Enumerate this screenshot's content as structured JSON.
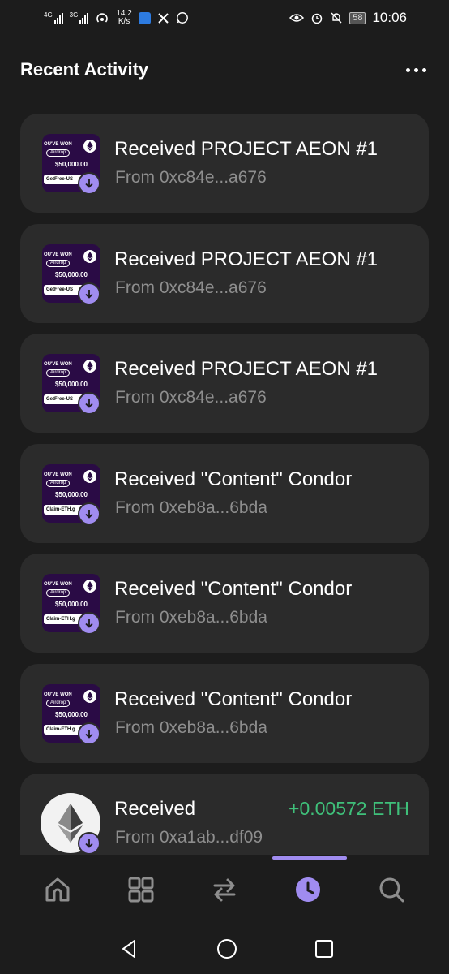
{
  "status_bar": {
    "signal1_label": "4G",
    "signal2_label": "3G",
    "speed_value": "14.2",
    "speed_unit": "K/s",
    "battery": "58",
    "time": "10:06"
  },
  "header": {
    "title": "Recent Activity"
  },
  "thumbnail": {
    "won_text": "OU'VE WON",
    "airdrop_text": "Airdrop",
    "amount_text": "$50,000.00",
    "claim_a": "GetFree-US",
    "claim_b": "Claim-ETH.g"
  },
  "activities": [
    {
      "title": "Received PROJECT AEON  #1",
      "from": "From 0xc84e...a676"
    },
    {
      "title": "Received PROJECT AEON  #1",
      "from": "From 0xc84e...a676"
    },
    {
      "title": "Received PROJECT AEON  #1",
      "from": "From 0xc84e...a676"
    },
    {
      "title": "Received \"Content\" Condor",
      "from": "From 0xeb8a...6bda"
    },
    {
      "title": "Received \"Content\" Condor",
      "from": "From 0xeb8a...6bda"
    },
    {
      "title": "Received \"Content\" Condor",
      "from": "From 0xeb8a...6bda"
    },
    {
      "title": "Received",
      "from": "From 0xa1ab...df09",
      "amount": "+0.00572 ETH"
    }
  ],
  "nav": {
    "items": [
      "home-icon",
      "grid-icon",
      "swap-icon",
      "clock-icon",
      "search-icon"
    ],
    "active": "clock-icon",
    "accent_color": "#a08cf0"
  },
  "colors": {
    "background": "#1c1c1c",
    "card": "#2b2b2b",
    "accent": "#a08cf0",
    "positive": "#3fc07a",
    "subtext": "#8e8e8e"
  }
}
